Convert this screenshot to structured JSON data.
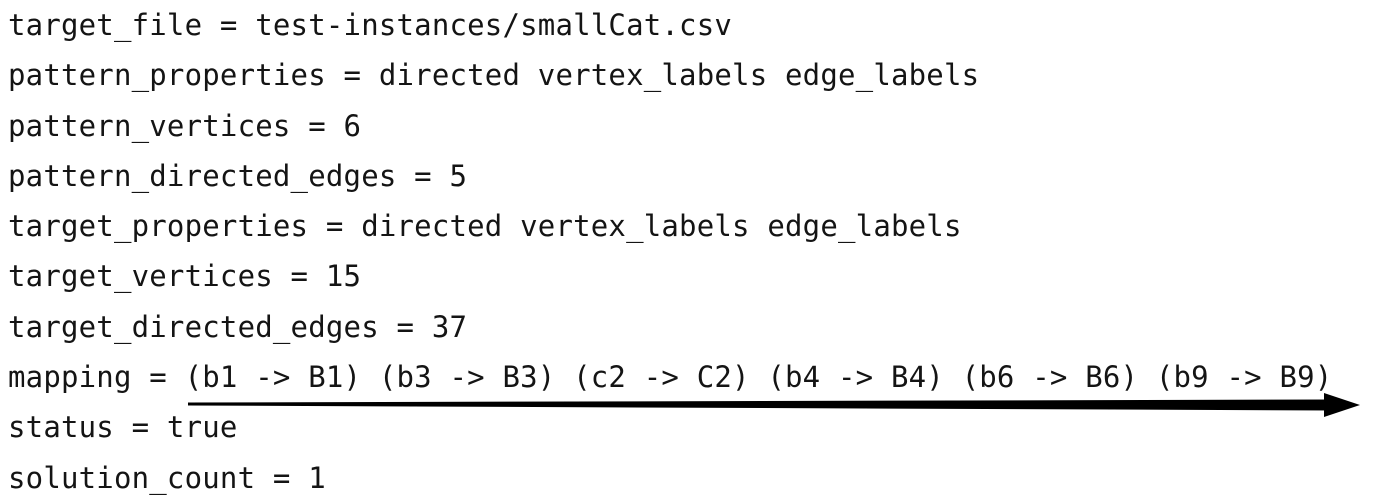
{
  "lines": [
    "target_file = test-instances/smallCat.csv",
    "pattern_properties = directed vertex_labels edge_labels",
    "pattern_vertices = 6",
    "pattern_directed_edges = 5",
    "target_properties = directed vertex_labels edge_labels",
    "target_vertices = 15",
    "target_directed_edges = 37",
    "mapping = (b1 -> B1) (b3 -> B3) (c2 -> C2) (b4 -> B4) (b6 -> B6) (b9 -> B9)",
    "status = true",
    "solution_count = 1"
  ],
  "colors": {
    "text": "#141414",
    "arrow": "#000000",
    "background": "#ffffff"
  }
}
